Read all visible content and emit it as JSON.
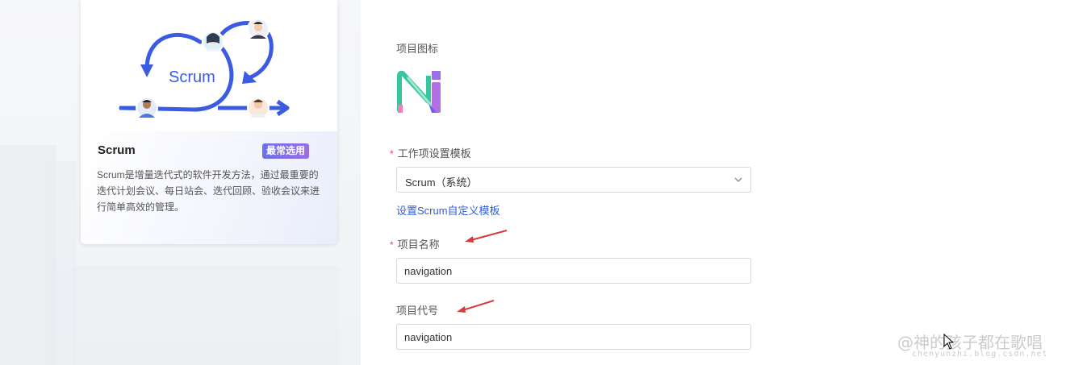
{
  "template_card": {
    "illustration_text": "Scrum",
    "title": "Scrum",
    "badge": "最常选用",
    "description": "Scrum是增量迭代式的软件开发方法，通过最重要的迭代计划会议、每日站会、迭代回顾、验收会议来进行简单高效的管理。"
  },
  "form": {
    "icon_label": "项目图标",
    "template_label": "工作项设置模板",
    "template_value": "Scrum（系统）",
    "custom_template_link": "设置Scrum自定义模板",
    "name_label": "项目名称",
    "name_value": "navigation",
    "code_label": "项目代号",
    "code_value": "navigation",
    "required_mark": "*"
  },
  "watermark": {
    "main": "@神的孩子都在歌唱",
    "sub": "chenyunzhi.blog.csdn.net"
  },
  "colors": {
    "accent_blue": "#3b5be0",
    "link": "#2f5fe0",
    "required": "#e34d59",
    "annotation_arrow": "#d63b3b",
    "logo_green": "#37c6a0",
    "logo_purple": "#9b6ee8",
    "logo_pink": "#ef7fb6"
  }
}
